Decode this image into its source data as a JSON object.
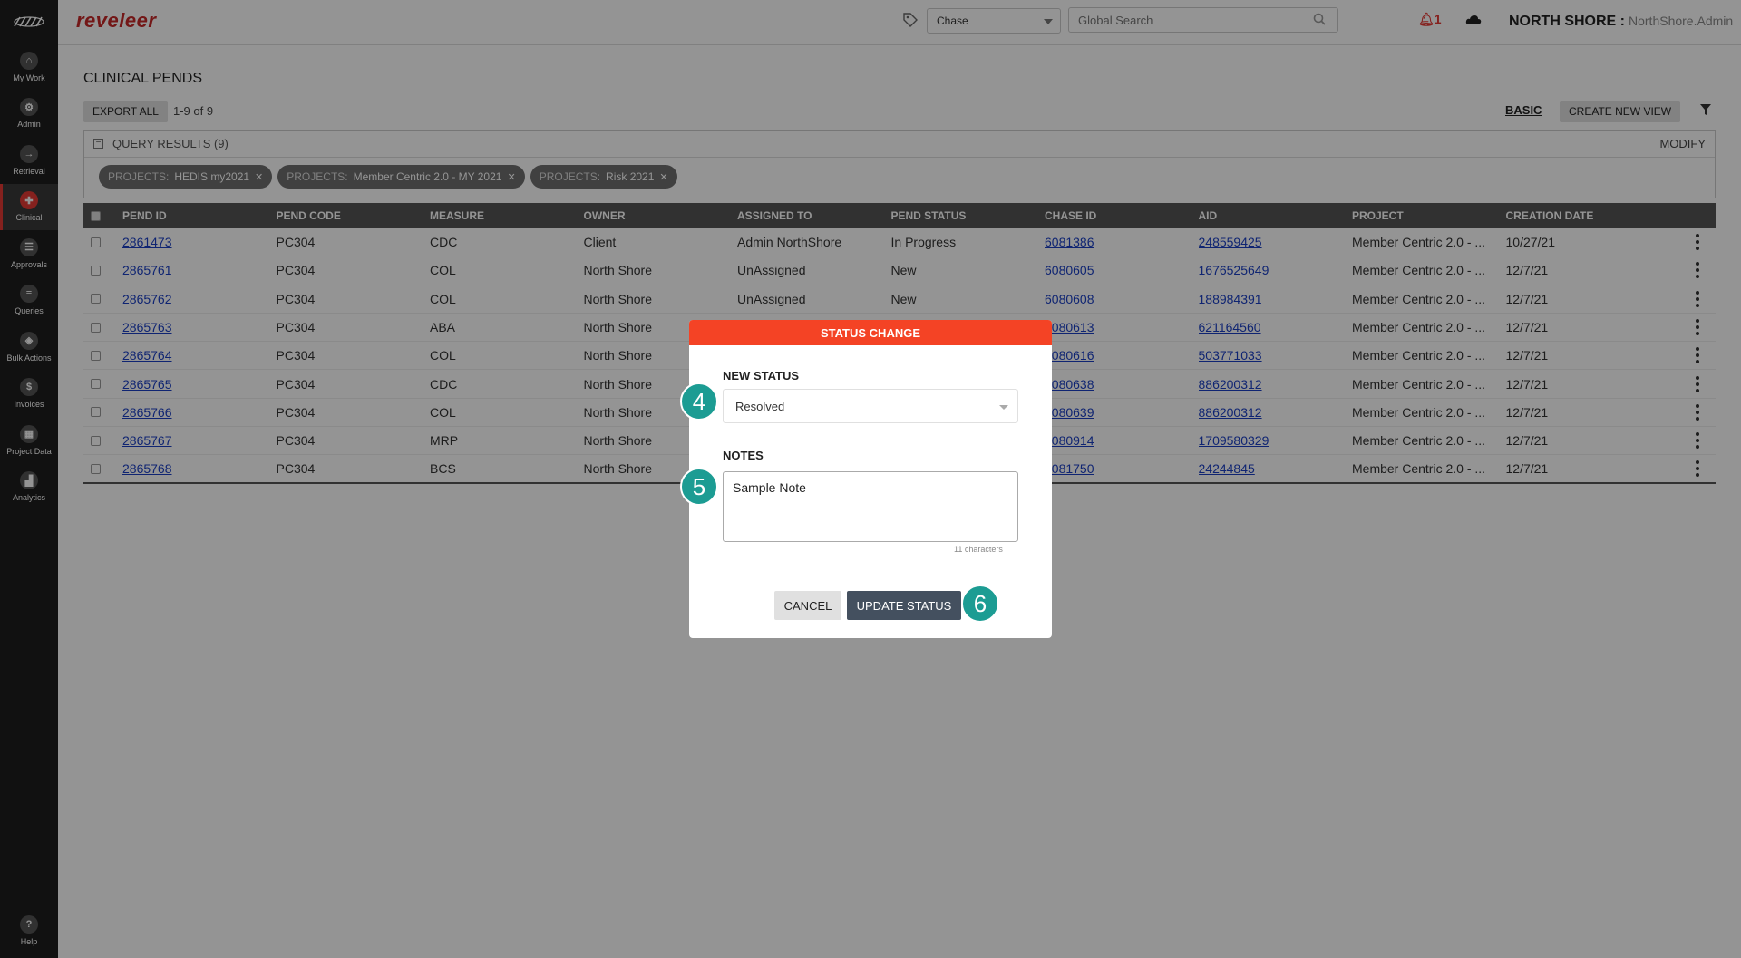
{
  "app": {
    "brand": "reveleer"
  },
  "sidebar": {
    "items": [
      {
        "label": "My Work",
        "icon": "home-icon",
        "glyph": "⌂"
      },
      {
        "label": "Admin",
        "icon": "gear-icon",
        "glyph": "⚙"
      },
      {
        "label": "Retrieval",
        "icon": "arrow-right-icon",
        "glyph": "→"
      },
      {
        "label": "Clinical",
        "icon": "clinical-icon",
        "glyph": "✚"
      },
      {
        "label": "Approvals",
        "icon": "list-icon",
        "glyph": "☰"
      },
      {
        "label": "Queries",
        "icon": "query-icon",
        "glyph": "≡"
      },
      {
        "label": "Bulk Actions",
        "icon": "layers-icon",
        "glyph": "◈"
      },
      {
        "label": "Invoices",
        "icon": "dollar-icon",
        "glyph": "$"
      },
      {
        "label": "Project Data",
        "icon": "grid-icon",
        "glyph": "▦"
      },
      {
        "label": "Analytics",
        "icon": "chart-icon",
        "glyph": "▟"
      }
    ],
    "help": {
      "label": "Help",
      "glyph": "?"
    }
  },
  "header": {
    "chase_select": "Chase",
    "search_placeholder": "Global Search",
    "bell_count": "1",
    "org": "NORTH SHORE :",
    "user": "NorthShore.Admin"
  },
  "main": {
    "title": "CLINICAL PENDS",
    "export_label": "EXPORT ALL",
    "count": "1-9  of  9",
    "basic_label": "BASIC",
    "create_view_label": "CREATE NEW VIEW",
    "query_results": "QUERY RESULTS (9)",
    "modify_label": "MODIFY",
    "chips": [
      {
        "key": "PROJECTS:",
        "value": "HEDIS my2021"
      },
      {
        "key": "PROJECTS:",
        "value": "Member Centric 2.0 - MY 2021"
      },
      {
        "key": "PROJECTS:",
        "value": "Risk 2021"
      }
    ]
  },
  "table": {
    "columns": [
      "PEND ID",
      "PEND CODE",
      "MEASURE",
      "OWNER",
      "ASSIGNED TO",
      "PEND STATUS",
      "CHASE ID",
      "AID",
      "PROJECT",
      "CREATION DATE"
    ],
    "rows": [
      [
        "2861473",
        "PC304",
        "CDC",
        "Client",
        "Admin NorthShore",
        "In Progress",
        "6081386",
        "248559425",
        "Member Centric 2.0 - ...",
        "10/27/21"
      ],
      [
        "2865761",
        "PC304",
        "COL",
        "North Shore",
        "UnAssigned",
        "New",
        "6080605",
        "1676525649",
        "Member Centric 2.0 - ...",
        "12/7/21"
      ],
      [
        "2865762",
        "PC304",
        "COL",
        "North Shore",
        "UnAssigned",
        "New",
        "6080608",
        "188984391",
        "Member Centric 2.0 - ...",
        "12/7/21"
      ],
      [
        "2865763",
        "PC304",
        "ABA",
        "North Shore",
        "",
        "",
        "6080613",
        "621164560",
        "Member Centric 2.0 - ...",
        "12/7/21"
      ],
      [
        "2865764",
        "PC304",
        "COL",
        "North Shore",
        "",
        "",
        "6080616",
        "503771033",
        "Member Centric 2.0 - ...",
        "12/7/21"
      ],
      [
        "2865765",
        "PC304",
        "CDC",
        "North Shore",
        "",
        "",
        "6080638",
        "886200312",
        "Member Centric 2.0 - ...",
        "12/7/21"
      ],
      [
        "2865766",
        "PC304",
        "COL",
        "North Shore",
        "",
        "",
        "6080639",
        "886200312",
        "Member Centric 2.0 - ...",
        "12/7/21"
      ],
      [
        "2865767",
        "PC304",
        "MRP",
        "North Shore",
        "",
        "",
        "6080914",
        "1709580329",
        "Member Centric 2.0 - ...",
        "12/7/21"
      ],
      [
        "2865768",
        "PC304",
        "BCS",
        "North Shore",
        "",
        "",
        "6081750",
        "24244845",
        "Member Centric 2.0 - ...",
        "12/7/21"
      ]
    ]
  },
  "modal": {
    "title": "STATUS CHANGE",
    "new_status_label": "NEW STATUS",
    "new_status_value": "Resolved",
    "notes_label": "NOTES",
    "notes_value": "Sample Note",
    "char_count": "11 characters",
    "cancel_label": "CANCEL",
    "update_label": "UPDATE STATUS",
    "steps": [
      "4",
      "5",
      "6"
    ]
  },
  "colors": {
    "brand": "#c62828",
    "modal_header": "#f44325",
    "step_badge": "#1c9c93",
    "link": "#1a3fc4"
  }
}
